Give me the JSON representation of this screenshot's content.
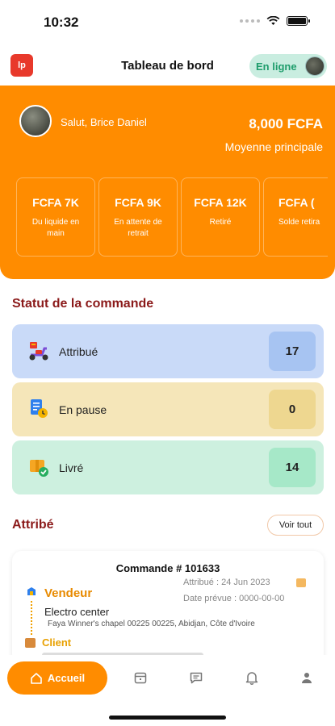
{
  "status_bar": {
    "time": "10:32"
  },
  "header": {
    "logo_text": "lp",
    "title": "Tableau de bord",
    "online_label": "En ligne"
  },
  "hero": {
    "greeting": "Salut, Brice Daniel",
    "balance_amount": "8,000 FCFA",
    "balance_label": "Moyenne principale",
    "cards": [
      {
        "value": "FCFA 7K",
        "label": "Du liquide en main"
      },
      {
        "value": "FCFA 9K",
        "label": "En attente de retrait"
      },
      {
        "value": "FCFA 12K",
        "label": "Retiré"
      },
      {
        "value": "FCFA (",
        "label": "Solde retira"
      }
    ]
  },
  "order_status": {
    "title": "Statut de la commande",
    "rows": [
      {
        "label": "Attribué",
        "count": "17",
        "bg": "#c9daf8",
        "badge": "#a7c4f2"
      },
      {
        "label": "En pause",
        "count": "0",
        "bg": "#f5e6b9",
        "badge": "#eed790"
      },
      {
        "label": "Livré",
        "count": "14",
        "bg": "#cdf0df",
        "badge": "#a6e8c8"
      }
    ]
  },
  "assigned": {
    "title": "Attribé",
    "view_all": "Voir tout",
    "order": {
      "title": "Commande # 101633",
      "vendor_label": "Vendeur",
      "assigned_date": "Attribué : 24 Jun 2023",
      "due_date": "Date prévue : 0000-00-00",
      "vendor_name": "Electro center",
      "vendor_address": "Faya Winner's chapel 00225 00225, Abidjan, Côte d'Ivoire",
      "client_label": "Client"
    }
  },
  "nav": {
    "home_label": "Accueil"
  },
  "colors": {
    "accent": "#ff8c00",
    "section_title": "#8b1a1a",
    "online": "#1f9d6c"
  }
}
